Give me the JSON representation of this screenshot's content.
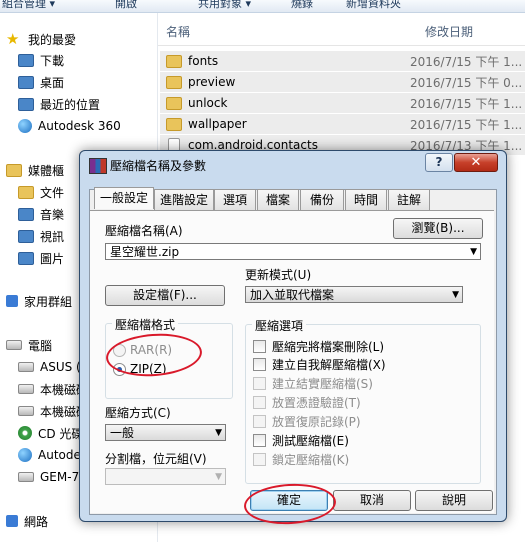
{
  "explorer": {
    "toolbar": [
      "組合管理 ▾",
      "開啟",
      "共用對象 ▾",
      "燒錄",
      "新增資料夾"
    ],
    "nav": {
      "favorites": "我的最愛",
      "fav_items": [
        "下載",
        "桌面",
        "最近的位置",
        "Autodesk 360"
      ],
      "libraries": "媒體櫃",
      "lib_items": [
        "文件",
        "音樂",
        "視訊",
        "圖片"
      ],
      "homegroup": "家用群組",
      "computer": "電腦",
      "computer_items": [
        "ASUS (C",
        "本機磁碟",
        "本機磁碟",
        "CD 光碟",
        "Autode",
        "GEM-70"
      ],
      "network": "網路"
    },
    "columns": {
      "name": "名稱",
      "date": "修改日期"
    },
    "files": [
      {
        "name": "fonts",
        "date": "2016/7/15 下午 1..."
      },
      {
        "name": "preview",
        "date": "2016/7/15 下午 0..."
      },
      {
        "name": "unlock",
        "date": "2016/7/15 下午 1..."
      },
      {
        "name": "wallpaper",
        "date": "2016/7/15 下午 1..."
      },
      {
        "name": "com.android.contacts",
        "date": "2016/7/13 下午 1..."
      }
    ]
  },
  "dialog": {
    "title": "壓縮檔名稱及參數",
    "help_label": "?",
    "close_label": "✕",
    "tabs": [
      "一般設定",
      "進階設定",
      "選項",
      "檔案",
      "備份",
      "時間",
      "註解"
    ],
    "archive_name_label": "壓縮檔名稱(A)",
    "browse_label": "瀏覽(B)...",
    "archive_name_value": "星空耀世.zip",
    "update_mode_label": "更新模式(U)",
    "profiles_label": "設定檔(F)...",
    "update_mode_value": "加入並取代檔案",
    "format_group": "壓縮檔格式",
    "format_rar": "RAR(R)",
    "format_zip": "ZIP(Z)",
    "method_label": "壓縮方式(C)",
    "method_value": "一般",
    "split_label": "分割檔，位元組(V)",
    "split_value": "",
    "options_group": "壓縮選項",
    "options": [
      {
        "label": "壓縮完將檔案刪除(L)",
        "enabled": true
      },
      {
        "label": "建立自我解壓縮檔(X)",
        "enabled": true
      },
      {
        "label": "建立結實壓縮檔(S)",
        "enabled": false
      },
      {
        "label": "放置憑證驗證(T)",
        "enabled": false
      },
      {
        "label": "放置復原記錄(P)",
        "enabled": false
      },
      {
        "label": "測試壓縮檔(E)",
        "enabled": true
      },
      {
        "label": "鎖定壓縮檔(K)",
        "enabled": false
      }
    ],
    "ok_label": "確定",
    "cancel_label": "取消",
    "help_button_label": "說明"
  }
}
